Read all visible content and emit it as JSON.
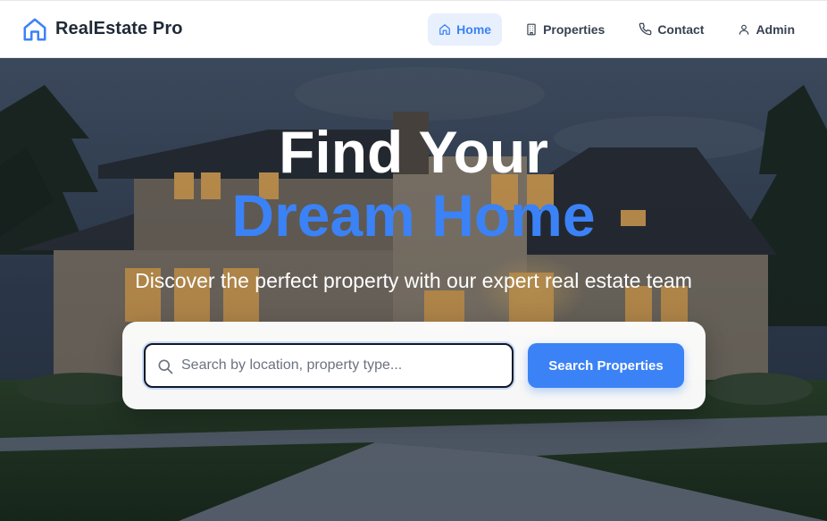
{
  "brand": {
    "name": "RealEstate Pro",
    "icon": "home-icon",
    "color": "#3b82f6"
  },
  "nav": {
    "items": [
      {
        "label": "Home",
        "icon": "home-icon",
        "active": true
      },
      {
        "label": "Properties",
        "icon": "building-icon",
        "active": false
      },
      {
        "label": "Contact",
        "icon": "phone-icon",
        "active": false
      },
      {
        "label": "Admin",
        "icon": "user-icon",
        "active": false
      }
    ]
  },
  "hero": {
    "title_line1": "Find Your",
    "title_line2": "Dream Home",
    "subtitle": "Discover the perfect property with our expert real estate team",
    "background": "house-at-dusk-photo"
  },
  "search": {
    "placeholder": "Search by location, property type...",
    "value": "",
    "button_label": "Search Properties",
    "icon": "search-icon"
  },
  "colors": {
    "accent": "#3b82f6",
    "active_nav_bg": "#e8f0fd",
    "text_dark": "#1f2937"
  }
}
